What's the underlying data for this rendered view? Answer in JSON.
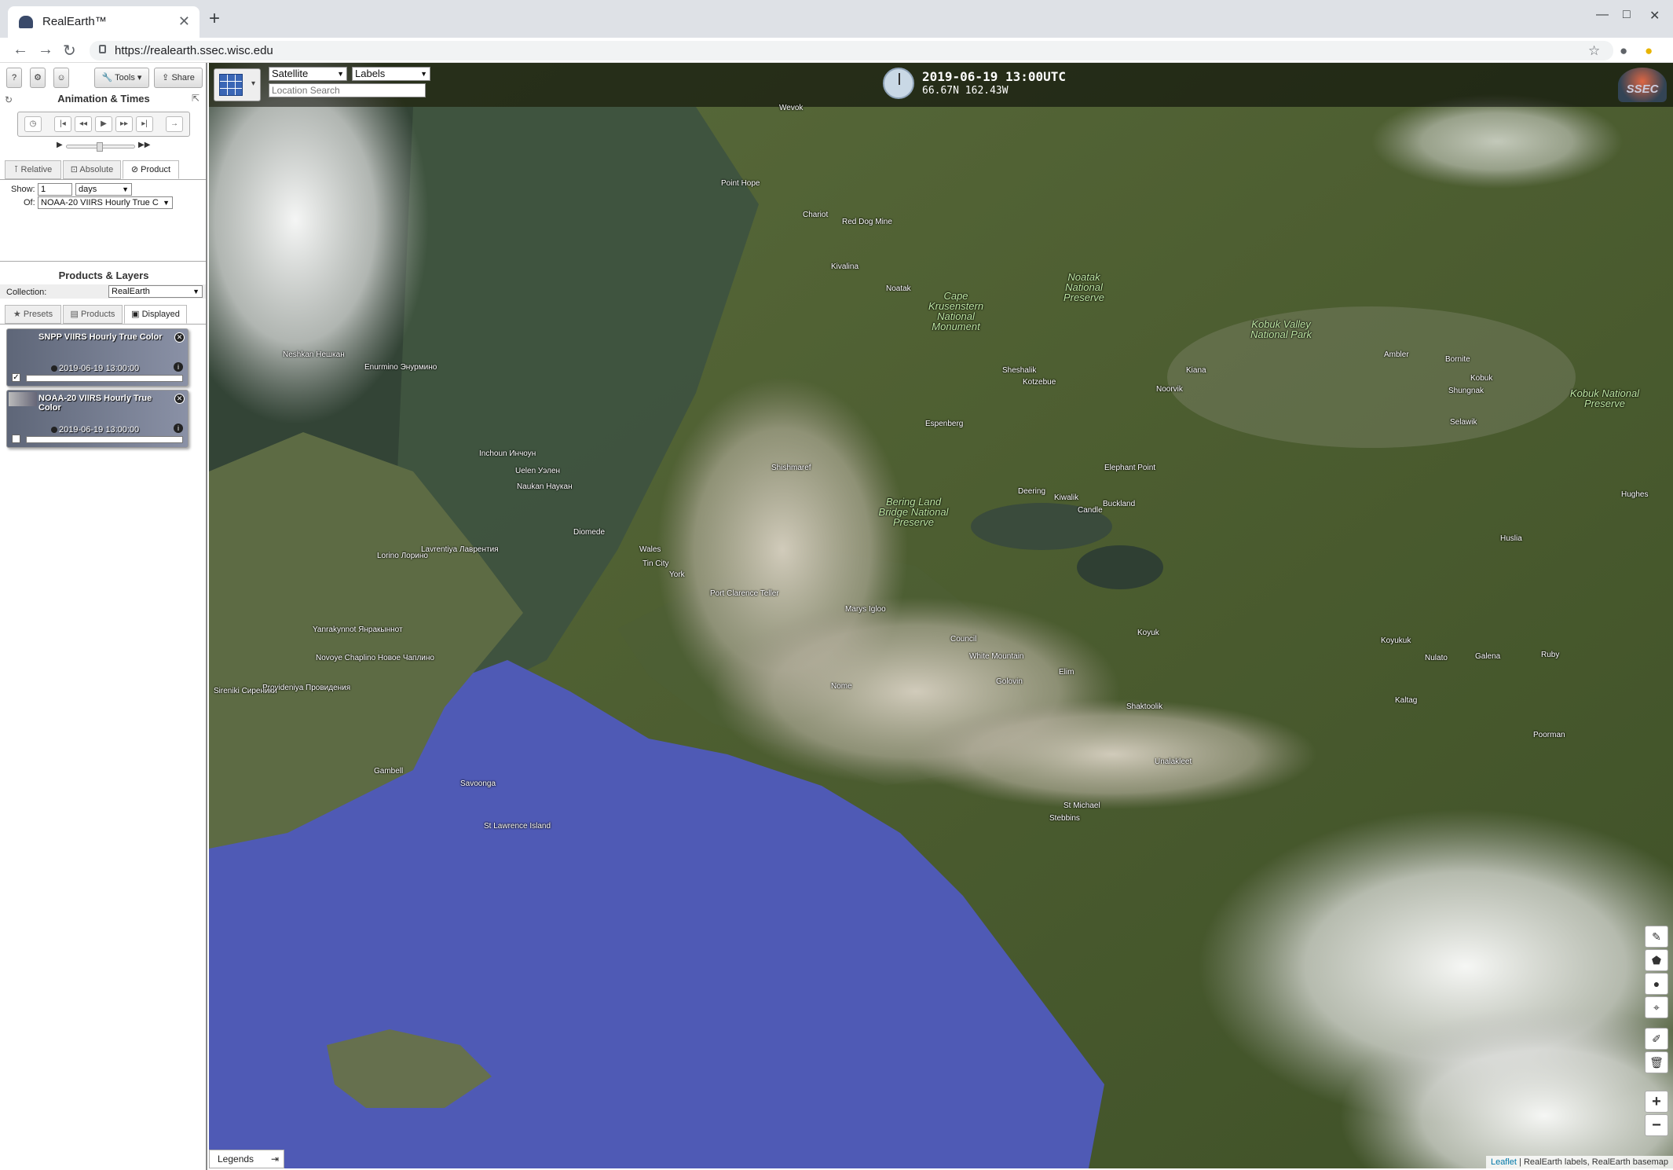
{
  "browser": {
    "tab_title": "RealEarth™",
    "tab_close": "✕",
    "new_tab": "+",
    "url": "https://realearth.ssec.wisc.edu"
  },
  "sidebar": {
    "top_buttons": {
      "help": "?",
      "settings": "⚙",
      "user": "☺",
      "tools": "Tools",
      "share": "Share"
    },
    "animation_title": "Animation & Times",
    "time_tabs": [
      "Relative",
      "Absolute",
      "Product"
    ],
    "show_label": "Show:",
    "show_value": "1",
    "show_unit": "days",
    "of_label": "Of:",
    "of_value": "NOAA-20 VIIRS Hourly True C",
    "products_title": "Products & Layers",
    "collection_label": "Collection:",
    "collection_value": "RealEarth",
    "layer_tabs": [
      "Presets",
      "Products",
      "Displayed"
    ],
    "layers": [
      {
        "title": "SNPP VIIRS Hourly True Color",
        "time": "2019-06-19 13:00:00",
        "checked": true
      },
      {
        "title": "NOAA-20 VIIRS Hourly True Color",
        "time": "2019-06-19 13:00:00",
        "checked": false
      }
    ]
  },
  "map": {
    "basemap_select": "Satellite",
    "labels_select": "Labels",
    "search_placeholder": "Location Search",
    "datetime": "2019-06-19 13:00UTC",
    "coords": "66.67N 162.43W",
    "logo": "SSEC",
    "legends": "Legends",
    "attribution_link": "Leaflet",
    "attribution_rest": " | RealEarth labels, RealEarth basemap",
    "tools": [
      "✎",
      "⬟",
      "●",
      "⌖",
      "✐",
      "🗑",
      "+",
      "−"
    ],
    "places": [
      "Wevok",
      "Point Hope",
      "Chariot",
      "Red Dog Mine",
      "Kivalina",
      "Noatak",
      "Sheshalik",
      "Kotzebue",
      "Kiana",
      "Noorvik",
      "Ambler",
      "Bornite",
      "Kobuk",
      "Shungnak",
      "Selawik",
      "Espenberg",
      "Shishmaref",
      "Elephant Point",
      "Deering",
      "Kiwalik",
      "Buckland",
      "Candle",
      "Hughes",
      "Huslia",
      "Diomede",
      "Wales",
      "Tin City",
      "York",
      "Port Clarence Teller",
      "Marys Igloo",
      "Koyuk",
      "Council",
      "White Mountain",
      "Elim",
      "Golovin",
      "Nome",
      "Shaktoolik",
      "Koyukuk",
      "Nulato",
      "Galena",
      "Ruby",
      "Kaltag",
      "Poorman",
      "Unalakleet",
      "St Michael",
      "Stebbins",
      "Gambell",
      "Savoonga",
      "St Lawrence Island",
      "Neshkan Нешкан",
      "Enurmino Энурмино",
      "Inchoun Инчоун",
      "Uelen Уэлен",
      "Naukan Наукан",
      "Lorino Лорино",
      "Lavrentiya Лаврентия",
      "Yanrakynnot Янракыннот",
      "Novoye Chaplino Новое Чаплино",
      "Provideniya Провидения",
      "Sireniki Сиреники"
    ],
    "parks": [
      "Noatak National Preserve",
      "Cape Krusenstern National Monument",
      "Kobuk Valley National Park",
      "Kobuk National Preserve",
      "Bering Land Bridge National Preserve"
    ]
  }
}
